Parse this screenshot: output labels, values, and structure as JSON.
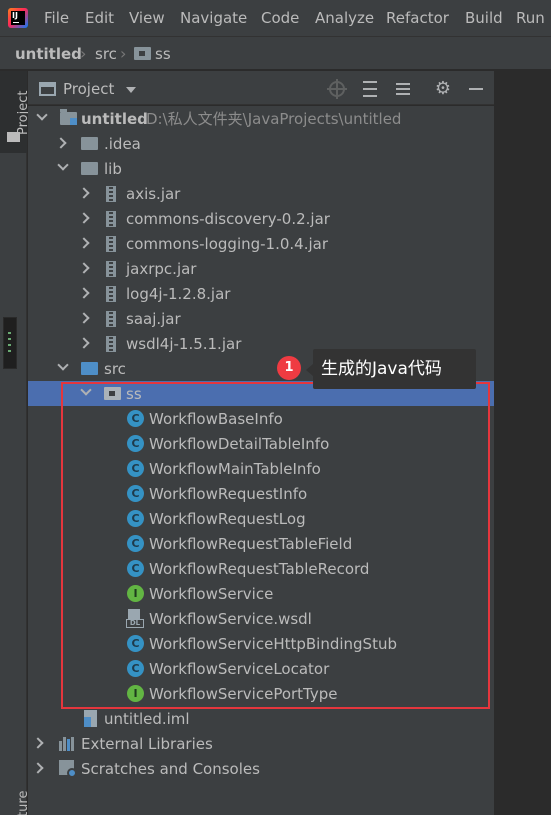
{
  "menu": {
    "items": [
      "File",
      "Edit",
      "View",
      "Navigate",
      "Code",
      "Analyze",
      "Refactor",
      "Build",
      "Run"
    ]
  },
  "breadcrumb": {
    "items": [
      "untitled",
      "src",
      "ss"
    ]
  },
  "left_strip": {
    "project_tab": "Project",
    "structure_tab": "Structure"
  },
  "project_panel": {
    "title": "Project",
    "root": {
      "name": "untitled",
      "path": "D:\\私人文件夹\\JavaProjects\\untitled"
    },
    "idea_folder": ".idea",
    "lib_folder": "lib",
    "jars": [
      "axis.jar",
      "commons-discovery-0.2.jar",
      "commons-logging-1.0.4.jar",
      "jaxrpc.jar",
      "log4j-1.2.8.jar",
      "saaj.jar",
      "wsdl4j-1.5.1.jar"
    ],
    "src_folder": "src",
    "package": "ss",
    "files": [
      {
        "name": "WorkflowBaseInfo",
        "kind": "class",
        "icon_letter": "C"
      },
      {
        "name": "WorkflowDetailTableInfo",
        "kind": "class",
        "icon_letter": "C"
      },
      {
        "name": "WorkflowMainTableInfo",
        "kind": "class",
        "icon_letter": "C"
      },
      {
        "name": "WorkflowRequestInfo",
        "kind": "class",
        "icon_letter": "C"
      },
      {
        "name": "WorkflowRequestLog",
        "kind": "class",
        "icon_letter": "C"
      },
      {
        "name": "WorkflowRequestTableField",
        "kind": "class",
        "icon_letter": "C"
      },
      {
        "name": "WorkflowRequestTableRecord",
        "kind": "class",
        "icon_letter": "C"
      },
      {
        "name": "WorkflowService",
        "kind": "interface",
        "icon_letter": "I"
      },
      {
        "name": "WorkflowService.wsdl",
        "kind": "wsdl",
        "icon_letter": "DL"
      },
      {
        "name": "WorkflowServiceHttpBindingStub",
        "kind": "class",
        "icon_letter": "C"
      },
      {
        "name": "WorkflowServiceLocator",
        "kind": "class",
        "icon_letter": "C"
      },
      {
        "name": "WorkflowServicePortType",
        "kind": "interface",
        "icon_letter": "I"
      }
    ],
    "iml_file": "untitled.iml",
    "external_libraries": "External Libraries",
    "scratches": "Scratches and Consoles"
  },
  "annotation": {
    "badge": "1",
    "text": "生成的Java代码",
    "color": "#e5363d"
  },
  "colors": {
    "selection": "#4b6eaf",
    "class_icon": "#3592c4",
    "interface_icon": "#62b543",
    "source_folder": "#4e8ec7"
  }
}
